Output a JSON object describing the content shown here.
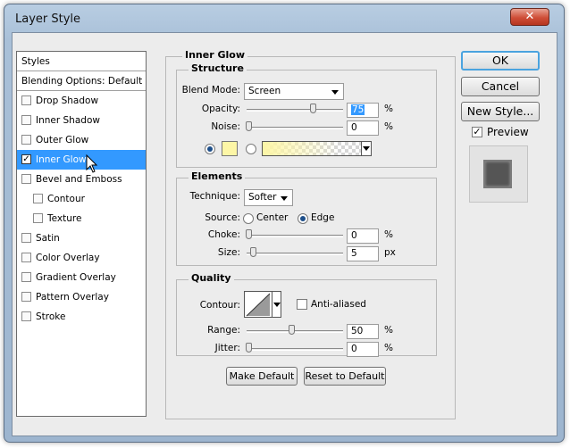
{
  "window": {
    "title": "Layer Style",
    "close_glyph": "✕"
  },
  "styles_panel": {
    "header": "Styles",
    "blending_options": "Blending Options: Default",
    "items": [
      {
        "label": "Drop Shadow",
        "checked": false,
        "indent": false
      },
      {
        "label": "Inner Shadow",
        "checked": false,
        "indent": false
      },
      {
        "label": "Outer Glow",
        "checked": false,
        "indent": false
      },
      {
        "label": "Inner Glow",
        "checked": true,
        "indent": false,
        "selected": true
      },
      {
        "label": "Bevel and Emboss",
        "checked": false,
        "indent": false
      },
      {
        "label": "Contour",
        "checked": false,
        "indent": true
      },
      {
        "label": "Texture",
        "checked": false,
        "indent": true
      },
      {
        "label": "Satin",
        "checked": false,
        "indent": false
      },
      {
        "label": "Color Overlay",
        "checked": false,
        "indent": false
      },
      {
        "label": "Gradient Overlay",
        "checked": false,
        "indent": false
      },
      {
        "label": "Pattern Overlay",
        "checked": false,
        "indent": false
      },
      {
        "label": "Stroke",
        "checked": false,
        "indent": false
      }
    ]
  },
  "inner_glow": {
    "title": "Inner Glow",
    "structure": {
      "title": "Structure",
      "blend_mode_label": "Blend Mode:",
      "blend_mode_value": "Screen",
      "opacity_label": "Opacity:",
      "opacity_value": "75",
      "noise_label": "Noise:",
      "noise_value": "0",
      "unit": "%",
      "color_swatch": "#fdf6a6"
    },
    "elements": {
      "title": "Elements",
      "technique_label": "Technique:",
      "technique_value": "Softer",
      "source_label": "Source:",
      "source_center": "Center",
      "source_edge": "Edge",
      "choke_label": "Choke:",
      "choke_value": "0",
      "choke_unit": "%",
      "size_label": "Size:",
      "size_value": "5",
      "size_unit": "px"
    },
    "quality": {
      "title": "Quality",
      "contour_label": "Contour:",
      "anti_aliased_label": "Anti-aliased",
      "range_label": "Range:",
      "range_value": "50",
      "range_unit": "%",
      "jitter_label": "Jitter:",
      "jitter_value": "0",
      "jitter_unit": "%"
    },
    "make_default": "Make Default",
    "reset_default": "Reset to Default"
  },
  "actions": {
    "ok": "OK",
    "cancel": "Cancel",
    "new_style": "New Style...",
    "preview_label": "Preview",
    "preview_checked": true
  }
}
